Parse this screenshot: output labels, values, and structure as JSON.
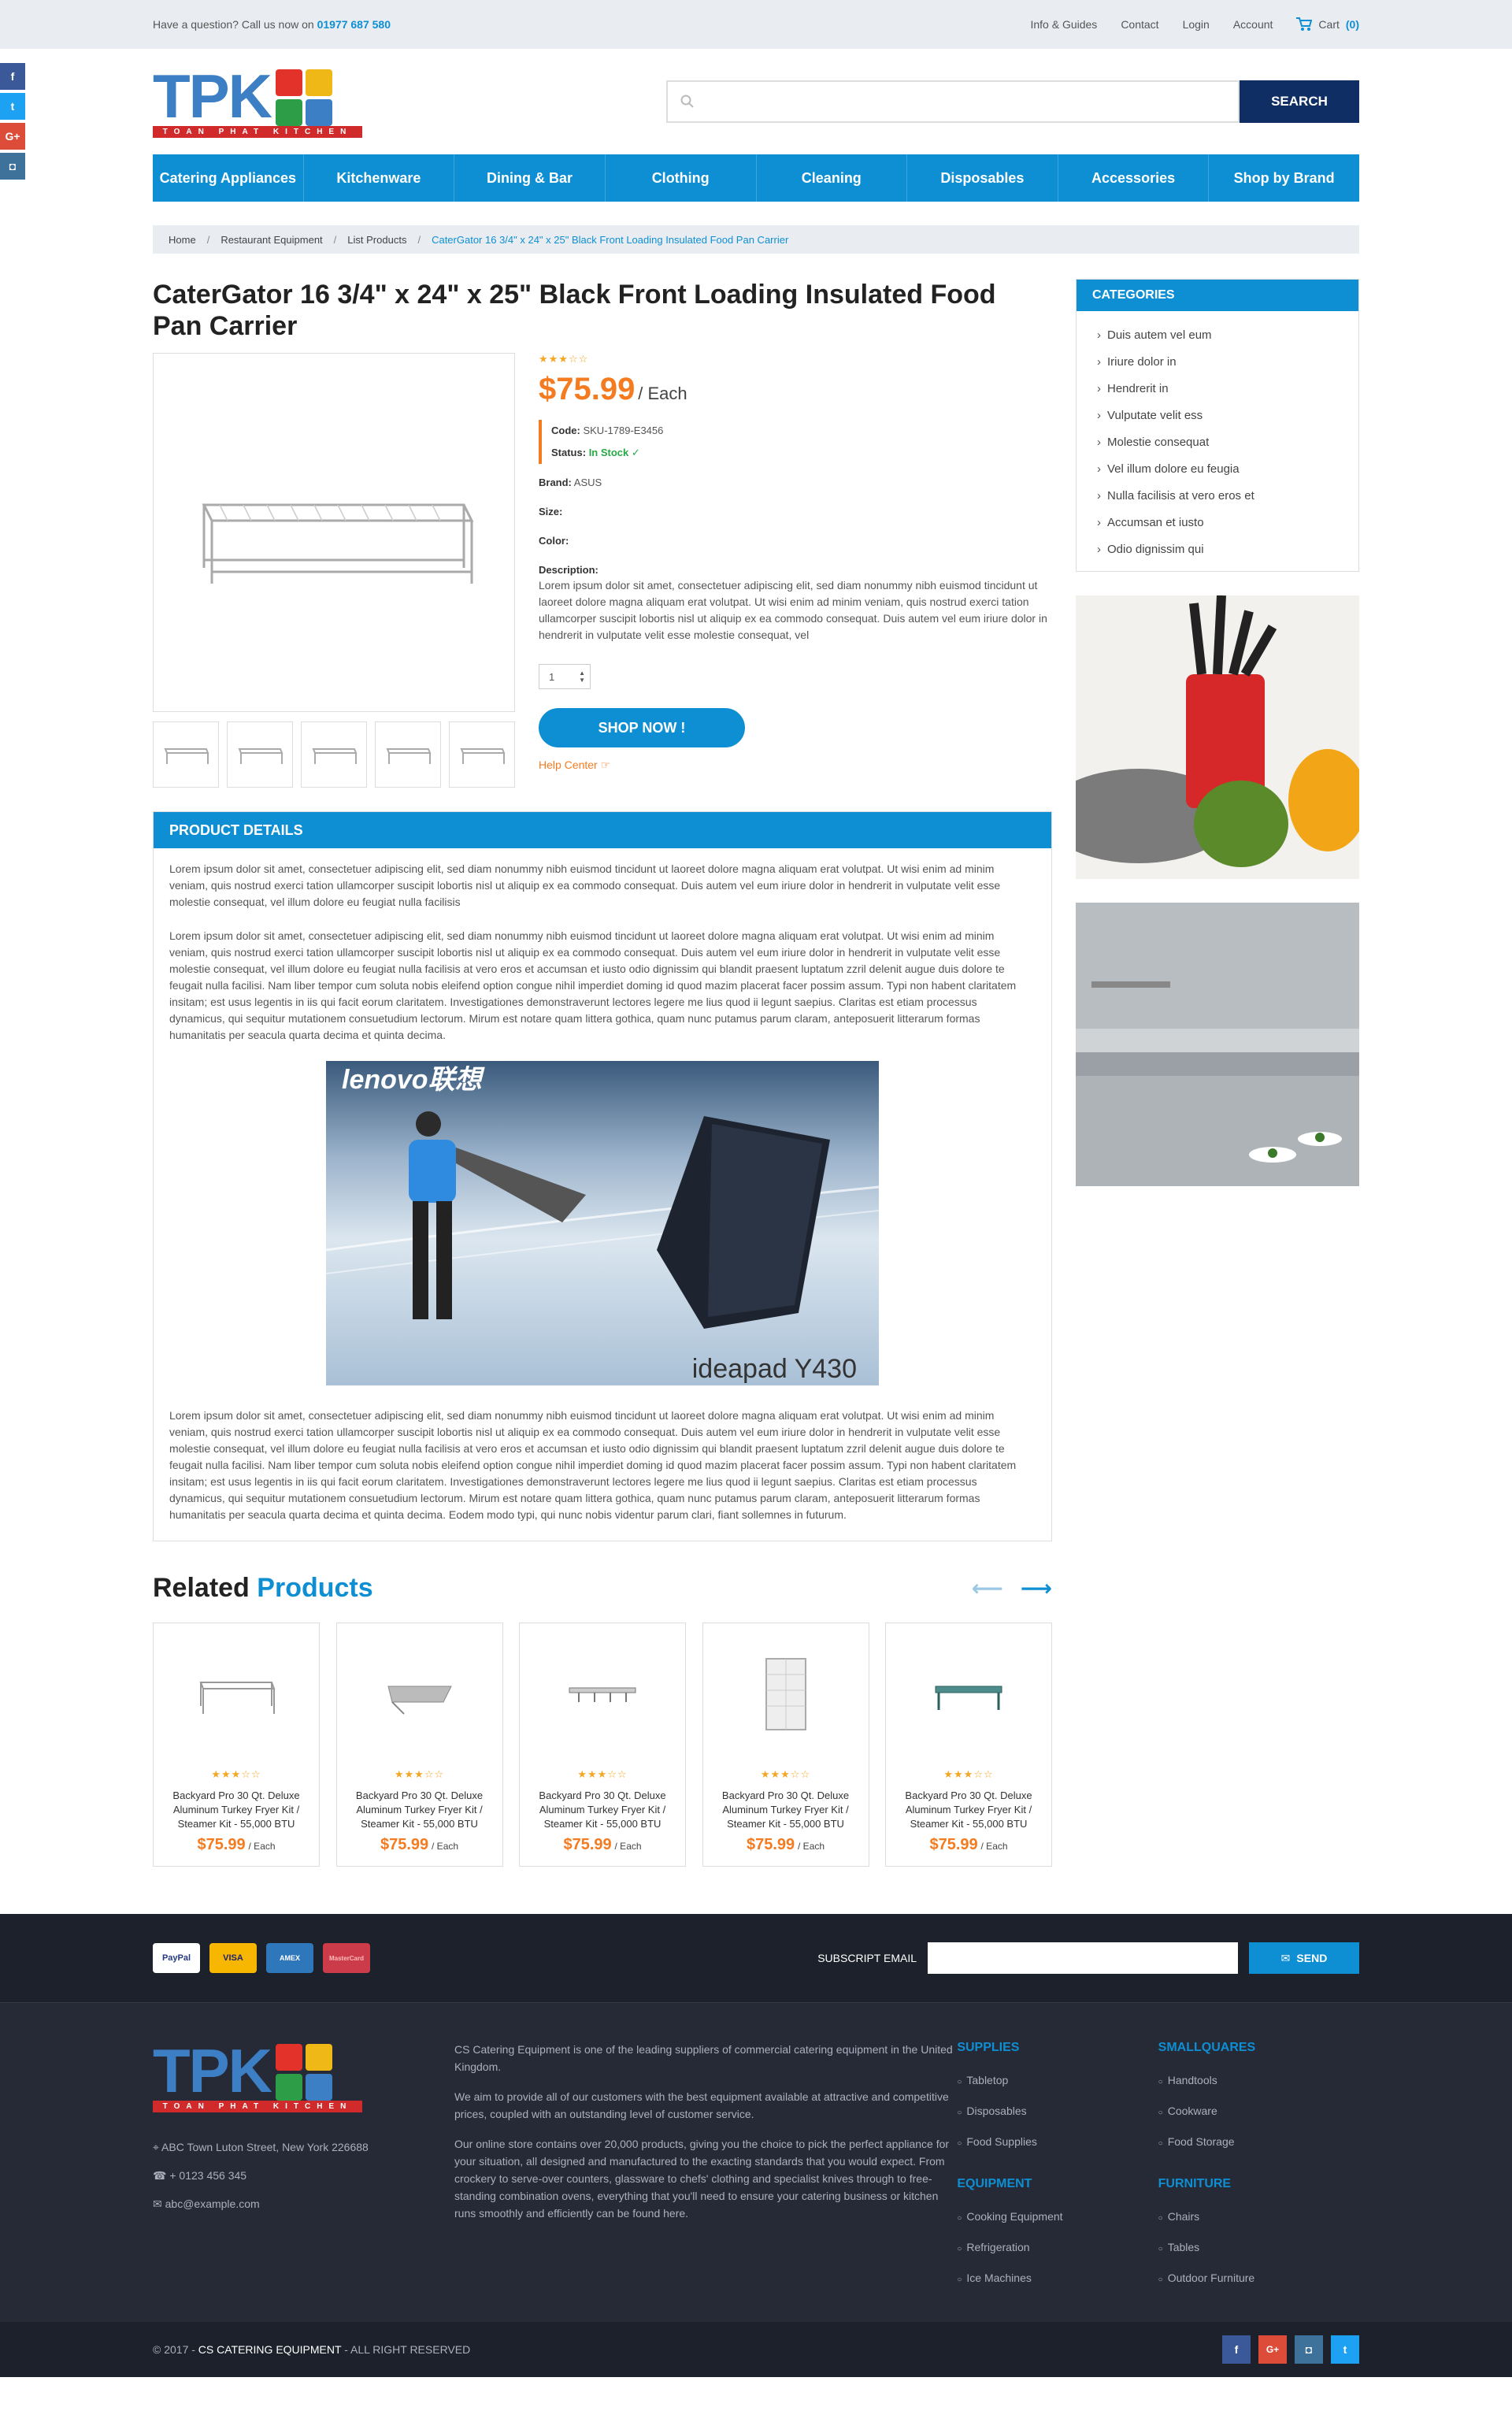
{
  "topbar": {
    "question": "Have a question? Call us now on",
    "phone": "01977 687 580",
    "links": [
      "Info & Guides",
      "Contact",
      "Login",
      "Account"
    ],
    "cart_label": "Cart",
    "cart_count": "(0)"
  },
  "logo": {
    "text": "TPK",
    "subtitle": "TOAN PHAT KITCHEN"
  },
  "search": {
    "placeholder": "",
    "button": "SEARCH"
  },
  "nav": [
    "Catering Appliances",
    "Kitchenware",
    "Dining & Bar",
    "Clothing",
    "Cleaning",
    "Disposables",
    "Accessories",
    "Shop by Brand"
  ],
  "breadcrumb": [
    "Home",
    "Restaurant Equipment",
    "List Products",
    "CaterGator 16 3/4\" x 24\" x 25\" Black Front Loading Insulated Food Pan Carrier"
  ],
  "product": {
    "title": "CaterGator 16 3/4\" x 24\" x 25\" Black Front Loading Insulated Food Pan Carrier",
    "stars": "★★★☆☆",
    "price": "$75.99",
    "unit": "/ Each",
    "code_label": "Code:",
    "code": "SKU-1789-E3456",
    "status_label": "Status:",
    "status": "In Stock",
    "brand_label": "Brand:",
    "brand": "ASUS",
    "size_label": "Size:",
    "color_label": "Color:",
    "description_label": "Description:",
    "description": "Lorem ipsum dolor sit amet, consectetuer adipiscing elit, sed diam nonummy nibh euismod tincidunt ut laoreet dolore magna aliquam erat volutpat. Ut wisi enim ad minim veniam, quis nostrud exerci tation ullamcorper suscipit lobortis nisl ut aliquip ex ea commodo consequat. Duis autem vel eum iriure dolor in hendrerit in vulputate velit esse molestie consequat, vel",
    "quantity": "1",
    "shop_now": "SHOP NOW !",
    "help_center": "Help Center"
  },
  "details": {
    "heading": "PRODUCT DETAILS",
    "p1": "Lorem ipsum dolor sit amet, consectetuer adipiscing elit, sed diam nonummy nibh euismod tincidunt ut laoreet dolore magna aliquam erat volutpat. Ut wisi enim ad minim veniam, quis nostrud exerci tation ullamcorper suscipit lobortis nisl ut aliquip ex ea commodo consequat. Duis autem vel eum iriure dolor in hendrerit in vulputate velit esse molestie consequat, vel illum dolore eu feugiat nulla facilisis",
    "p2": "Lorem ipsum dolor sit amet, consectetuer adipiscing elit, sed diam nonummy nibh euismod tincidunt ut laoreet dolore magna aliquam erat volutpat. Ut wisi enim ad minim veniam, quis nostrud exerci tation ullamcorper suscipit lobortis nisl ut aliquip ex ea commodo consequat. Duis autem vel eum iriure dolor in hendrerit in vulputate velit esse molestie consequat, vel illum dolore eu feugiat nulla facilisis at vero eros et accumsan et iusto odio dignissim qui blandit praesent luptatum zzril delenit augue duis dolore te feugait nulla facilisi. Nam liber tempor cum soluta nobis eleifend option congue nihil imperdiet doming id quod mazim placerat facer possim assum. Typi non habent claritatem insitam; est usus legentis in iis qui facit eorum claritatem. Investigationes demonstraverunt lectores legere me lius quod ii legunt saepius. Claritas est etiam processus dynamicus, qui sequitur mutationem consuetudium lectorum. Mirum est notare quam littera gothica, quam nunc putamus parum claram, anteposuerit litterarum formas humanitatis per seacula quarta decima et quinta decima.",
    "banner_brand": "lenovo联想",
    "banner_model": "ideapad Y430",
    "p3": "Lorem ipsum dolor sit amet, consectetuer adipiscing elit, sed diam nonummy nibh euismod tincidunt ut laoreet dolore magna aliquam erat volutpat. Ut wisi enim ad minim veniam, quis nostrud exerci tation ullamcorper suscipit lobortis nisl ut aliquip ex ea commodo consequat. Duis autem vel eum iriure dolor in hendrerit in vulputate velit esse molestie consequat, vel illum dolore eu feugiat nulla facilisis at vero eros et accumsan et iusto odio dignissim qui blandit praesent luptatum zzril delenit augue duis dolore te feugait nulla facilisi. Nam liber tempor cum soluta nobis eleifend option congue nihil imperdiet doming id quod mazim placerat facer possim assum. Typi non habent claritatem insitam; est usus legentis in iis qui facit eorum claritatem. Investigationes demonstraverunt lectores legere me lius quod ii legunt saepius. Claritas est etiam processus dynamicus, qui sequitur mutationem consuetudium lectorum. Mirum est notare quam littera gothica, quam nunc putamus parum claram, anteposuerit litterarum formas humanitatis per seacula quarta decima et quinta decima. Eodem modo typi, qui nunc nobis videntur parum clari, fiant sollemnes in futurum."
  },
  "related": {
    "title_a": "Related",
    "title_b": "Products",
    "items": [
      {
        "stars": "★★★☆☆",
        "name": "Backyard Pro 30 Qt. Deluxe Aluminum Turkey Fryer Kit / Steamer Kit - 55,000 BTU",
        "price": "$75.99",
        "unit": "/ Each"
      },
      {
        "stars": "★★★☆☆",
        "name": "Backyard Pro 30 Qt. Deluxe Aluminum Turkey Fryer Kit / Steamer Kit - 55,000 BTU",
        "price": "$75.99",
        "unit": "/ Each"
      },
      {
        "stars": "★★★☆☆",
        "name": "Backyard Pro 30 Qt. Deluxe Aluminum Turkey Fryer Kit / Steamer Kit - 55,000 BTU",
        "price": "$75.99",
        "unit": "/ Each"
      },
      {
        "stars": "★★★☆☆",
        "name": "Backyard Pro 30 Qt. Deluxe Aluminum Turkey Fryer Kit / Steamer Kit - 55,000 BTU",
        "price": "$75.99",
        "unit": "/ Each"
      },
      {
        "stars": "★★★☆☆",
        "name": "Backyard Pro 30 Qt. Deluxe Aluminum Turkey Fryer Kit / Steamer Kit - 55,000 BTU",
        "price": "$75.99",
        "unit": "/ Each"
      }
    ]
  },
  "categories": {
    "heading": "CATEGORIES",
    "items": [
      "Duis autem vel eum",
      "Iriure dolor in",
      "Hendrerit in",
      "Vulputate velit ess",
      "Molestie consequat",
      "Vel illum dolore eu feugia",
      "Nulla facilisis at vero eros et",
      "Accumsan et iusto",
      "Odio dignissim qui"
    ]
  },
  "footer": {
    "payments": [
      "PayPal",
      "VISA",
      "AMEX",
      "MasterCard"
    ],
    "subscribe_label": "SUBSCRIPT EMAIL",
    "send": "SEND",
    "address": "ABC Town Luton Street, New York 226688",
    "phone": "+ 0123 456 345",
    "email": "abc@example.com",
    "about_p1": "CS Catering Equipment is one of the leading suppliers of commercial catering equipment in the United Kingdom.",
    "about_p2": "We aim to provide all of our customers with the best equipment available at attractive and competitive prices, coupled with an outstanding level of customer service.",
    "about_p3": "Our online store contains over 20,000 products, giving you the choice to pick the perfect appliance for your situation, all designed and manufactured to the exacting standards that you would expect. From crockery to serve-over counters, glassware to chefs' clothing and specialist knives through to free-standing combination ovens, everything that you'll need to ensure your catering business or kitchen runs smoothly and efficiently can be found here.",
    "supplies_title": "SUPPLIES",
    "supplies": [
      "Tabletop",
      "Disposables",
      "Food Supplies"
    ],
    "equipment_title": "EQUIPMENT",
    "equipment": [
      "Cooking Equipment",
      "Refrigeration",
      "Ice Machines"
    ],
    "smallquares_title": "SMALLQUARES",
    "smallquares": [
      "Handtools",
      "Cookware",
      "Food Storage"
    ],
    "furniture_title": "FURNITURE",
    "furniture": [
      "Chairs",
      "Tables",
      "Outdoor Furniture"
    ],
    "copyright_a": "© 2017 -",
    "copyright_brand": "CS CATERING EQUIPMENT",
    "copyright_b": "- ALL RIGHT RESERVED"
  },
  "colors": {
    "primary": "#0e8fd3",
    "accent": "#f47b20",
    "navy": "#0f2e63",
    "footer": "#1d212b"
  }
}
